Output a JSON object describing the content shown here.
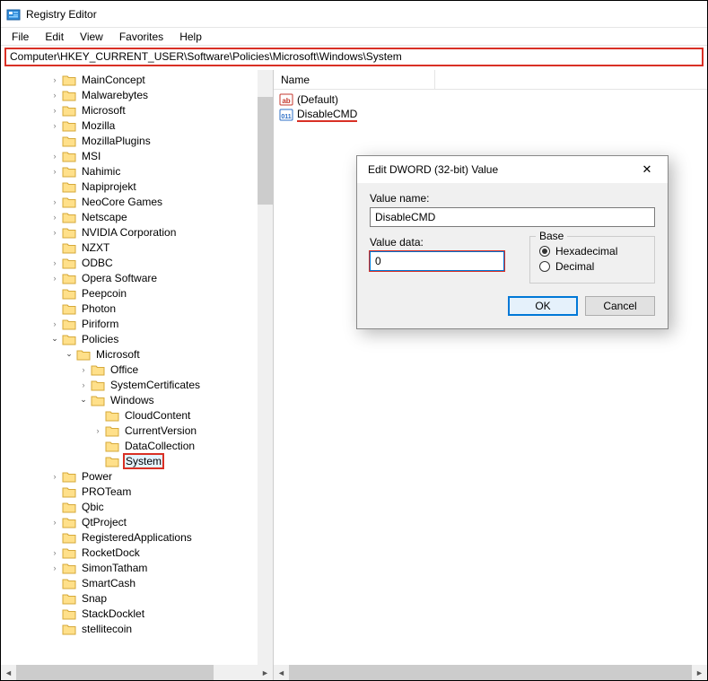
{
  "window": {
    "title": "Registry Editor"
  },
  "menus": [
    "File",
    "Edit",
    "View",
    "Favorites",
    "Help"
  ],
  "address": "Computer\\HKEY_CURRENT_USER\\Software\\Policies\\Microsoft\\Windows\\System",
  "tree": [
    {
      "depth": 3,
      "toggle": ">",
      "label": "MainConcept"
    },
    {
      "depth": 3,
      "toggle": ">",
      "label": "Malwarebytes"
    },
    {
      "depth": 3,
      "toggle": ">",
      "label": "Microsoft"
    },
    {
      "depth": 3,
      "toggle": ">",
      "label": "Mozilla"
    },
    {
      "depth": 3,
      "toggle": "",
      "label": "MozillaPlugins"
    },
    {
      "depth": 3,
      "toggle": ">",
      "label": "MSI"
    },
    {
      "depth": 3,
      "toggle": ">",
      "label": "Nahimic"
    },
    {
      "depth": 3,
      "toggle": "",
      "label": "Napiprojekt"
    },
    {
      "depth": 3,
      "toggle": ">",
      "label": "NeoCore Games"
    },
    {
      "depth": 3,
      "toggle": ">",
      "label": "Netscape"
    },
    {
      "depth": 3,
      "toggle": ">",
      "label": "NVIDIA Corporation"
    },
    {
      "depth": 3,
      "toggle": "",
      "label": "NZXT"
    },
    {
      "depth": 3,
      "toggle": ">",
      "label": "ODBC"
    },
    {
      "depth": 3,
      "toggle": ">",
      "label": "Opera Software"
    },
    {
      "depth": 3,
      "toggle": "",
      "label": "Peepcoin"
    },
    {
      "depth": 3,
      "toggle": "",
      "label": "Photon"
    },
    {
      "depth": 3,
      "toggle": ">",
      "label": "Piriform"
    },
    {
      "depth": 3,
      "toggle": "v",
      "label": "Policies"
    },
    {
      "depth": 4,
      "toggle": "v",
      "label": "Microsoft"
    },
    {
      "depth": 5,
      "toggle": ">",
      "label": "Office"
    },
    {
      "depth": 5,
      "toggle": ">",
      "label": "SystemCertificates"
    },
    {
      "depth": 5,
      "toggle": "v",
      "label": "Windows"
    },
    {
      "depth": 6,
      "toggle": "",
      "label": "CloudContent"
    },
    {
      "depth": 6,
      "toggle": ">",
      "label": "CurrentVersion"
    },
    {
      "depth": 6,
      "toggle": "",
      "label": "DataCollection"
    },
    {
      "depth": 6,
      "toggle": "",
      "label": "System",
      "selected": true
    },
    {
      "depth": 3,
      "toggle": ">",
      "label": "Power"
    },
    {
      "depth": 3,
      "toggle": "",
      "label": "PROTeam"
    },
    {
      "depth": 3,
      "toggle": "",
      "label": "Qbic"
    },
    {
      "depth": 3,
      "toggle": ">",
      "label": "QtProject"
    },
    {
      "depth": 3,
      "toggle": "",
      "label": "RegisteredApplications"
    },
    {
      "depth": 3,
      "toggle": ">",
      "label": "RocketDock"
    },
    {
      "depth": 3,
      "toggle": ">",
      "label": "SimonTatham"
    },
    {
      "depth": 3,
      "toggle": "",
      "label": "SmartCash"
    },
    {
      "depth": 3,
      "toggle": "",
      "label": "Snap"
    },
    {
      "depth": 3,
      "toggle": "",
      "label": "StackDocklet"
    },
    {
      "depth": 3,
      "toggle": "",
      "label": "stellitecoin"
    }
  ],
  "list": {
    "header": {
      "name": "Name"
    },
    "items": [
      {
        "icon": "string",
        "label": "(Default)"
      },
      {
        "icon": "dword",
        "label": "DisableCMD",
        "highlighted": true
      }
    ]
  },
  "dialog": {
    "title": "Edit DWORD (32-bit) Value",
    "valueNameLabel": "Value name:",
    "valueName": "DisableCMD",
    "valueDataLabel": "Value data:",
    "valueData": "0",
    "baseLabel": "Base",
    "hexLabel": "Hexadecimal",
    "decLabel": "Decimal",
    "ok": "OK",
    "cancel": "Cancel"
  }
}
